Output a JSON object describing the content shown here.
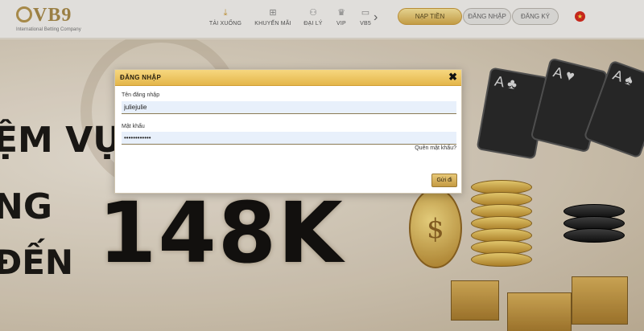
{
  "header": {
    "logo_text": "VB9",
    "logo_subtitle": "International Betting Company",
    "nav": [
      {
        "label": "TẢI XUỐNG",
        "icon": "download-icon"
      },
      {
        "label": "KHUYẾN MÃI",
        "icon": "gift-icon"
      },
      {
        "label": "ĐẠI LÝ",
        "icon": "agent-icon"
      },
      {
        "label": "VIP",
        "icon": "crown-icon"
      },
      {
        "label": "VB5",
        "icon": "vb5-icon"
      }
    ],
    "chevron": "›",
    "deposit_label": "NẠP TIỀN",
    "login_label": "ĐĂNG NHẬP",
    "register_label": "ĐĂNG KÝ",
    "flag_icon": "vietnam-flag-icon"
  },
  "hero": {
    "line1": "ỆM VỤ",
    "line2": "NG",
    "line3": "ĐẾN",
    "amount": "148K"
  },
  "login_modal": {
    "title": "ĐĂNG NHẬP",
    "close_symbol": "✖",
    "username_label": "Tên đăng nhập",
    "username_value": "juliejulie",
    "password_label": "Mật khẩu",
    "password_value": "••••••••••••",
    "forgot_link": "Quên mật khẩu?",
    "submit_label": "Gửi đi"
  },
  "colors": {
    "accent_gold": "#e4b64a",
    "button_gold": "#d3a94b",
    "input_bg": "#e8f0fb"
  }
}
